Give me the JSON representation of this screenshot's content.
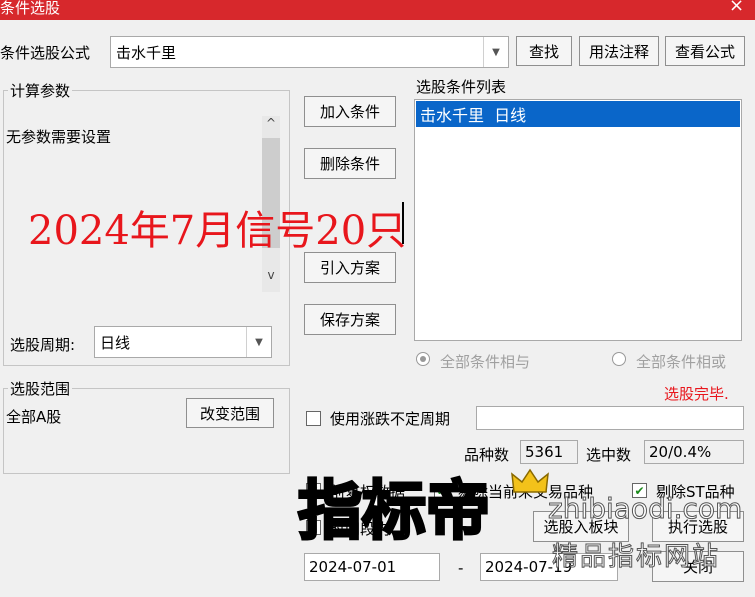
{
  "window": {
    "title": "条件选股",
    "close_glyph": "×"
  },
  "formula": {
    "label": "条件选股公式",
    "value": "击水千里",
    "find": "查找",
    "usage": "用法注释",
    "view": "查看公式"
  },
  "params": {
    "legend": "计算参数",
    "message": "无参数需要设置",
    "annotation": "2024年7月信号20只",
    "annotation_color": "#e8161c"
  },
  "period": {
    "label": "选股周期:",
    "value": "日线"
  },
  "actions": {
    "add": "加入条件",
    "delete": "删除条件",
    "import": "引入方案",
    "save": "保存方案"
  },
  "conditions": {
    "label": "选股条件列表",
    "items": [
      "击水千里  日线"
    ],
    "selected_color": "#0a66c9"
  },
  "logic": {
    "and_label": "全部条件相与",
    "or_label": "全部条件相或",
    "selected": "and"
  },
  "status": {
    "text": "选股完毕.",
    "color": "#e8161c"
  },
  "range": {
    "legend": "选股范围",
    "value": "全部A股",
    "change": "改变范围"
  },
  "uncertain_period": {
    "label": "使用涨跌不定周期",
    "checked": false
  },
  "counts": {
    "species_label": "品种数",
    "species_value": "5361",
    "selected_label": "选中数",
    "selected_value": "20/0.4%"
  },
  "options": [
    {
      "label": "前复权数据",
      "checked": true
    },
    {
      "label": "剔除当前未交易品种",
      "checked": true
    },
    {
      "label": "剔除ST品种",
      "checked": true
    }
  ],
  "bottom": {
    "time_label": "时间段内",
    "to_board": "选股入板块",
    "execute": "执行选股",
    "close": "关闭",
    "date_from": "2024-07-01",
    "date_sep": "-",
    "date_to": "2024-07-19"
  },
  "watermark": {
    "main": "指标帝",
    "url": "zhibiaodi.com",
    "sub": "精品指标网站"
  }
}
